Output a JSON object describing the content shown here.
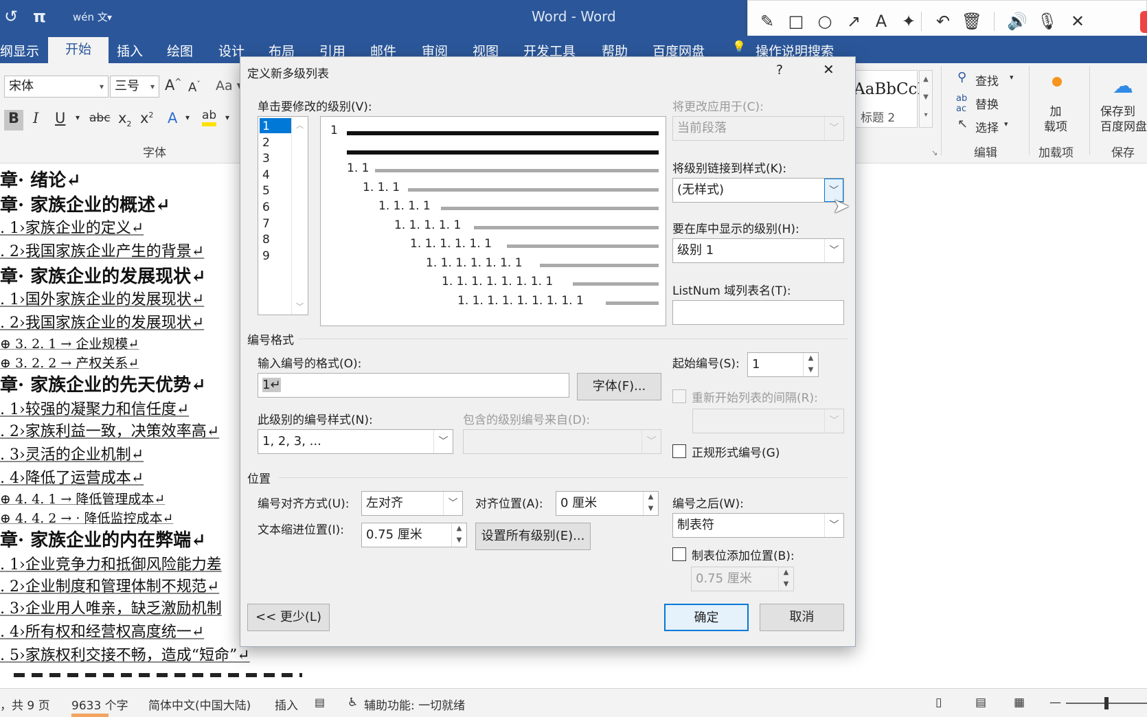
{
  "window": {
    "title": "Word - Word"
  },
  "quick_access": {
    "undo": "↺",
    "pi": "π",
    "wen": "wén 文",
    "more": "▾"
  },
  "annotation_toolbar": {
    "icons": [
      "pencil-icon",
      "rectangle-icon",
      "circle-icon",
      "arrow-icon",
      "text-icon",
      "magic-wand-icon",
      "undo-icon",
      "trash-icon",
      "speaker-icon",
      "microphone-icon",
      "close-icon"
    ],
    "glyphs": [
      "✎",
      "□",
      "○",
      "↗",
      "A",
      "✦",
      "↶",
      "🗑",
      "🔊",
      "🎙",
      "✕"
    ]
  },
  "ribbon": {
    "tabs": [
      "纲显示",
      "开始",
      "插入",
      "绘图",
      "设计",
      "布局",
      "引用",
      "邮件",
      "审阅",
      "视图",
      "开发工具",
      "帮助",
      "百度网盘",
      "操作说明搜索"
    ],
    "active_tab": "开始",
    "font_name": "宋体",
    "font_size": "三号",
    "font_group_label": "字体",
    "style_preview": "AaBbCcI",
    "style_name": "标题 2",
    "edit": {
      "find": "查找",
      "replace": "替换",
      "select": "选择",
      "group": "编辑"
    },
    "addins": {
      "label": "加\n载项",
      "group": "加载项"
    },
    "save": {
      "label": "保存到\n百度网盘",
      "group": "保存"
    }
  },
  "document": {
    "lines": [
      {
        "cls": "h1",
        "text": "章· 绪论↵"
      },
      {
        "cls": "h1",
        "text": "章· 家族企业的概述↵"
      },
      {
        "cls": "h2",
        "text": ". 1›家族企业的定义↵"
      },
      {
        "cls": "h2",
        "text": ". 2›我国家族企业产生的背景↵"
      },
      {
        "cls": "h1",
        "text": "章· 家族企业的发展现状↵"
      },
      {
        "cls": "h2",
        "text": ". 1›国外家族企业的发展现状↵"
      },
      {
        "cls": "h2",
        "text": ". 2›我国家族企业的发展现状↵"
      },
      {
        "cls": "h3",
        "text": "⊕  3. 2. 1 → 企业规模↵"
      },
      {
        "cls": "h3",
        "text": "⊕  3. 2. 2 → 产权关系↵"
      },
      {
        "cls": "h1",
        "text": "章· 家族企业的先天优势↵"
      },
      {
        "cls": "h2",
        "text": ". 1›较强的凝聚力和信任度↵"
      },
      {
        "cls": "h2",
        "text": ". 2›家族利益一致，决策效率高↵"
      },
      {
        "cls": "h2",
        "text": ". 3›灵活的企业机制↵"
      },
      {
        "cls": "h2",
        "text": ". 4›降低了运营成本↵"
      },
      {
        "cls": "h3",
        "text": "⊕  4. 4. 1 → 降低管理成本↵"
      },
      {
        "cls": "h3",
        "text": "⊕  4. 4. 2 → · 降低监控成本↵"
      },
      {
        "cls": "h1",
        "text": "章· 家族企业的内在弊端↵"
      },
      {
        "cls": "h2",
        "text": ". 1›企业竞争力和抵御风险能力差"
      },
      {
        "cls": "h2",
        "text": ". 2›企业制度和管理体制不规范↵"
      },
      {
        "cls": "h2",
        "text": ". 3›企业用人唯亲，缺乏激励机制"
      },
      {
        "cls": "h2",
        "text": ". 4›所有权和经营权高度统一↵"
      },
      {
        "cls": "h2",
        "text": ". 5›家族权利交接不畅，造成“短命”↵"
      }
    ]
  },
  "status_bar": {
    "pages": "，共 9 页",
    "words": "9633 个字",
    "language": "简体中文(中国大陆)",
    "mode": "插入",
    "accessibility": "辅助功能: 一切就绪"
  },
  "dialog": {
    "title": "定义新多级列表",
    "help": "?",
    "close": "✕",
    "level_label": "单击要修改的级别(V):",
    "levels": [
      "1",
      "2",
      "3",
      "4",
      "5",
      "6",
      "7",
      "8",
      "9"
    ],
    "selected_level": "1",
    "preview_numbers": [
      "1",
      "",
      "1. 1",
      "1. 1. 1",
      "1. 1. 1. 1",
      "1. 1. 1. 1. 1",
      "1. 1. 1. 1. 1. 1",
      "1. 1. 1. 1. 1. 1. 1",
      "1. 1. 1. 1. 1. 1. 1. 1",
      "1. 1. 1. 1. 1. 1. 1. 1. 1"
    ],
    "apply_to_label": "将更改应用于(C):",
    "apply_to_value": "当前段落",
    "link_style_label": "将级别链接到样式(K):",
    "link_style_value": "(无样式)",
    "gallery_level_label": "要在库中显示的级别(H):",
    "gallery_level_value": "级别 1",
    "listnum_label": "ListNum 域列表名(T):",
    "listnum_value": "",
    "number_format_section": "编号格式",
    "enter_format_label": "输入编号的格式(O):",
    "enter_format_value": "1↵",
    "font_button": "字体(F)...",
    "start_at_label": "起始编号(S):",
    "start_at_value": "1",
    "restart_label": "重新开始列表的间隔(R):",
    "number_style_label": "此级别的编号样式(N):",
    "number_style_value": "1, 2, 3, ...",
    "include_level_label": "包含的级别编号来自(D):",
    "legal_label": "正规形式编号(G)",
    "position_section": "位置",
    "alignment_label": "编号对齐方式(U):",
    "alignment_value": "左对齐",
    "aligned_at_label": "对齐位置(A):",
    "aligned_at_value": "0 厘米",
    "follow_label": "编号之后(W):",
    "follow_value": "制表符",
    "indent_label": "文本缩进位置(I):",
    "indent_value": "0.75 厘米",
    "set_all_button": "设置所有级别(E)...",
    "tab_stop_label": "制表位添加位置(B):",
    "tab_stop_value": "0.75 厘米",
    "less_button": "<< 更少(L)",
    "ok_button": "确定",
    "cancel_button": "取消"
  }
}
